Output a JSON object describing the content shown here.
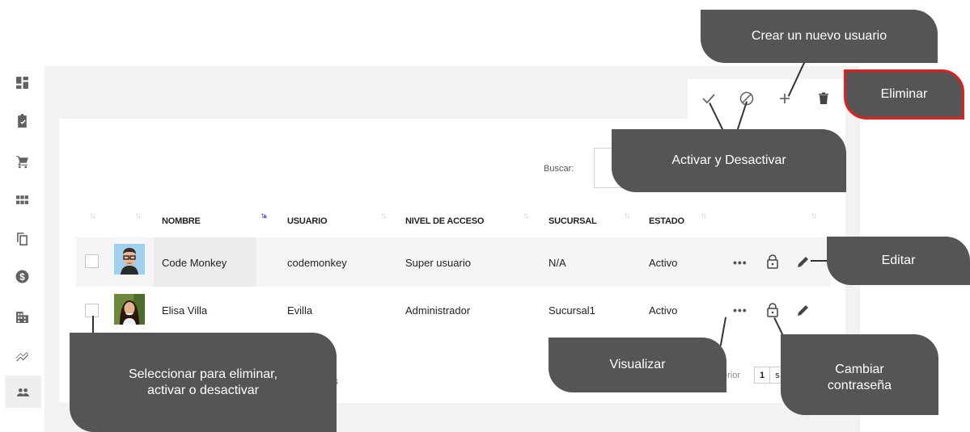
{
  "sidebar": {
    "items": [
      {
        "icon": "dashboard-icon"
      },
      {
        "icon": "clipboard-check-icon"
      },
      {
        "icon": "cart-icon"
      },
      {
        "icon": "grid-icon"
      },
      {
        "icon": "copy-icon"
      },
      {
        "icon": "dollar-icon"
      },
      {
        "icon": "building-icon"
      },
      {
        "icon": "trending-icon"
      },
      {
        "icon": "users-icon",
        "active": true
      }
    ]
  },
  "toolbar": {
    "activate_icon": "check-icon",
    "deactivate_icon": "block-icon",
    "add_icon": "plus-icon",
    "delete_icon": "trash-icon"
  },
  "search": {
    "label": "Buscar:",
    "value": ""
  },
  "table": {
    "columns": [
      "NOMBRE",
      "USUARIO",
      "NIVEL DE ACCESO",
      "SUCURSAL",
      "ESTADO"
    ],
    "rows": [
      {
        "nombre": "Code Monkey",
        "usuario": "codemonkey",
        "nivel": "Super usuario",
        "sucursal": "N/A",
        "estado": "Activo"
      },
      {
        "nombre": "Elisa Villa",
        "usuario": "Evilla",
        "nivel": "Administrador",
        "sucursal": "Sucursal1",
        "estado": "Activo"
      }
    ],
    "row_actions": {
      "view": "•••"
    }
  },
  "pagination": {
    "prev_label": "erior",
    "current_page": "1",
    "next_partial": "s",
    "info_partial": "s"
  },
  "callouts": {
    "create": "Crear un nuevo usuario",
    "delete": "Eliminar",
    "toggle": "Activar y Desactivar",
    "edit": "Editar",
    "view": "Visualizar",
    "password_line1": "Cambiar",
    "password_line2": "contraseña",
    "select_line1": "Seleccionar para eliminar,",
    "select_line2": "activar o desactivar"
  },
  "colors": {
    "callout_bg": "#555555",
    "delete_border": "#e0201f",
    "sort_active": "#6a5acd"
  }
}
